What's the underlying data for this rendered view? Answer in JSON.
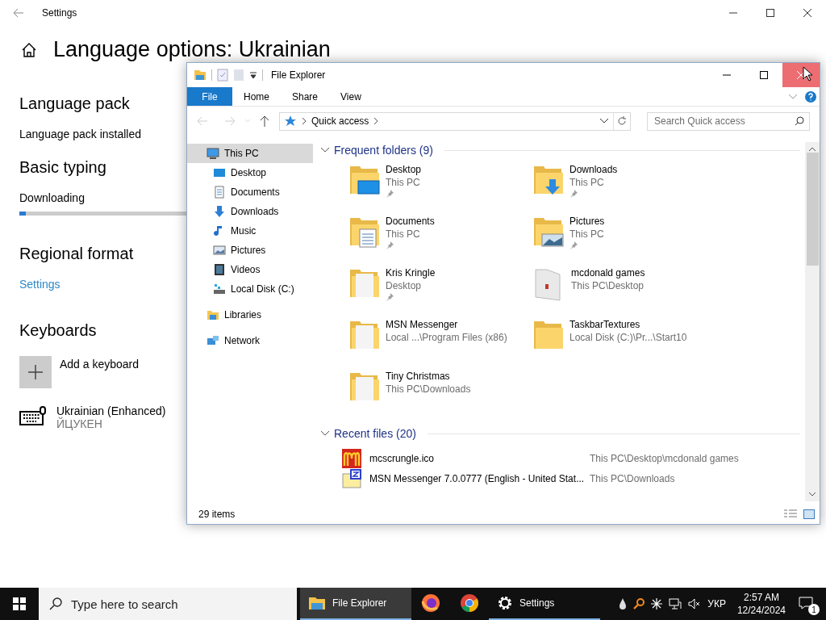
{
  "settings": {
    "window_title": "Settings",
    "page_title": "Language options: Ukrainian",
    "sections": [
      {
        "heading": "Language pack",
        "kind": "status",
        "text": "Language pack installed"
      },
      {
        "heading": "Basic typing",
        "kind": "progress",
        "text": "Downloading",
        "level": 0.03
      },
      {
        "heading": "Regional format",
        "kind": "link",
        "text": "Settings"
      },
      {
        "heading": "Keyboards",
        "kind": "keyboards",
        "add_label": "Add a keyboard",
        "keyboards": [
          {
            "name": "Ukrainian (Enhanced)",
            "layout": "ЙЦУКЕН"
          }
        ]
      }
    ]
  },
  "explorer": {
    "title": "File Explorer",
    "ribbon_tabs": [
      {
        "label": "File",
        "kind": "file"
      },
      {
        "label": "Home",
        "kind": "tab"
      },
      {
        "label": "Share",
        "kind": "tab"
      },
      {
        "label": "View",
        "kind": "tab"
      }
    ],
    "address": {
      "path": [
        "Quick access"
      ]
    },
    "search": {
      "placeholder": "Search Quick access"
    },
    "nav": [
      {
        "label": "This PC",
        "kind": "pc",
        "selected": true,
        "children": [
          {
            "label": "Desktop",
            "kind": "desktop",
            "selected": false
          },
          {
            "label": "Documents",
            "kind": "documents",
            "selected": false
          },
          {
            "label": "Downloads",
            "kind": "downloads",
            "selected": false
          },
          {
            "label": "Music",
            "kind": "music",
            "selected": false
          },
          {
            "label": "Pictures",
            "kind": "pictures",
            "selected": false
          },
          {
            "label": "Videos",
            "kind": "videos",
            "selected": false
          },
          {
            "label": "Local Disk (C:)",
            "kind": "disk",
            "selected": false
          }
        ]
      },
      {
        "label": "Libraries",
        "kind": "libraries",
        "selected": false
      },
      {
        "label": "Network",
        "kind": "network",
        "selected": false
      }
    ],
    "frequent": {
      "title": "Frequent folders (9)",
      "folders": [
        {
          "name": "Desktop",
          "location": "This PC",
          "pinned": true,
          "kind": "desktop"
        },
        {
          "name": "Downloads",
          "location": "This PC",
          "pinned": true,
          "kind": "downloads"
        },
        {
          "name": "Documents",
          "location": "This PC",
          "pinned": true,
          "kind": "documents"
        },
        {
          "name": "Pictures",
          "location": "This PC",
          "pinned": true,
          "kind": "pictures"
        },
        {
          "name": "Kris Kringle",
          "location": "Desktop",
          "pinned": true,
          "kind": "paper"
        },
        {
          "name": "mcdonald games",
          "location": "This PC\\Desktop",
          "pinned": false,
          "kind": "white"
        },
        {
          "name": "MSN Messenger",
          "location": "Local ...\\Program Files (x86)",
          "pinned": false,
          "kind": "paper"
        },
        {
          "name": "TaskbarTextures",
          "location": "Local Disk (C:)\\Pr...\\Start10",
          "pinned": false,
          "kind": "plain"
        },
        {
          "name": "Tiny Christmas",
          "location": "This PC\\Downloads",
          "pinned": false,
          "kind": "paper"
        }
      ]
    },
    "recent": {
      "title": "Recent files (20)",
      "files": [
        {
          "name": "mcscrungle.ico",
          "location": "This PC\\Desktop\\mcdonald games",
          "kind": "arches"
        },
        {
          "name": "MSN Messenger 7.0.0777 (English - United Stat...",
          "location": "This PC\\Downloads",
          "kind": "installer"
        }
      ]
    },
    "status": "29 items"
  },
  "taskbar": {
    "search_placeholder": "Type here to search",
    "apps": [
      {
        "label": "File Explorer",
        "kind": "explorer",
        "active": true,
        "running": true
      },
      {
        "kind": "firefox",
        "active": false,
        "running": false
      },
      {
        "kind": "chrome",
        "active": false,
        "running": false
      },
      {
        "label": "Settings",
        "kind": "settings",
        "active": false,
        "running": true
      }
    ],
    "language": "УКР",
    "time": "2:57 AM",
    "date": "12/24/2024",
    "notifications": "1"
  }
}
